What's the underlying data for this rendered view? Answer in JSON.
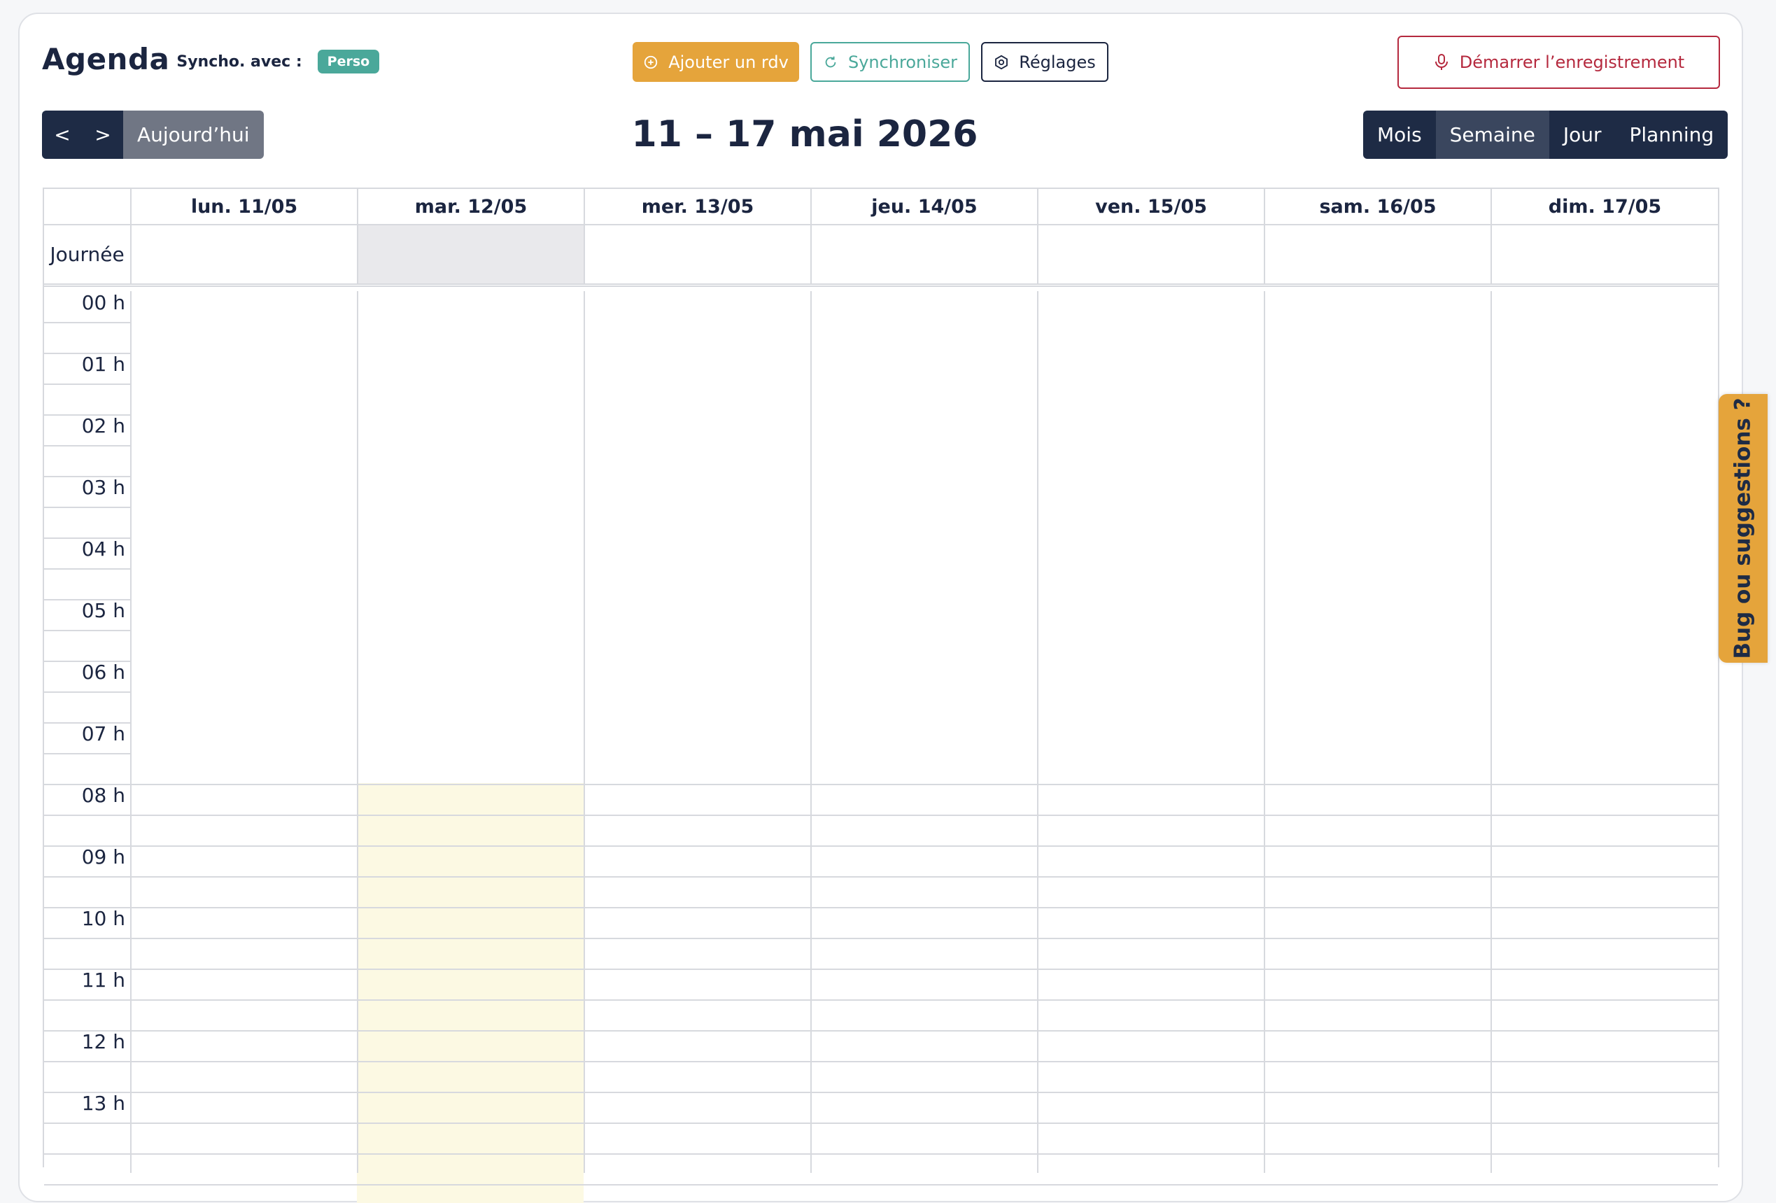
{
  "header": {
    "title": "Agenda",
    "sync_label": "Syncho. avec :",
    "sync_badge": "Perso",
    "add_button": "Ajouter un rdv",
    "sync_button": "Synchroniser",
    "settings_button": "Réglages",
    "record_button": "Démarrer l’enregistrement"
  },
  "toolbar": {
    "prev": "<",
    "next": ">",
    "today": "Aujourd’hui",
    "range_title": "11 – 17 mai 2026",
    "views": [
      "Mois",
      "Semaine",
      "Jour",
      "Planning"
    ],
    "active_view": "Semaine"
  },
  "calendar": {
    "days": [
      "lun. 11/05",
      "mar. 12/05",
      "mer. 13/05",
      "jeu. 14/05",
      "ven. 15/05",
      "sam. 16/05",
      "dim. 17/05"
    ],
    "today_index": 1,
    "allday_label": "Journée",
    "hours": [
      "00 h",
      "01 h",
      "02 h",
      "03 h",
      "04 h",
      "05 h",
      "06 h",
      "07 h",
      "08 h",
      "09 h",
      "10 h",
      "11 h",
      "12 h",
      "13 h"
    ]
  },
  "feedback_tab": "Bug ou suggestions ?",
  "colors": {
    "primary": "#1e2b45",
    "accent_orange": "#e5a43b",
    "teal": "#4aa89a",
    "record_red": "#b5293e",
    "today_highlight": "#fcf9e3"
  }
}
